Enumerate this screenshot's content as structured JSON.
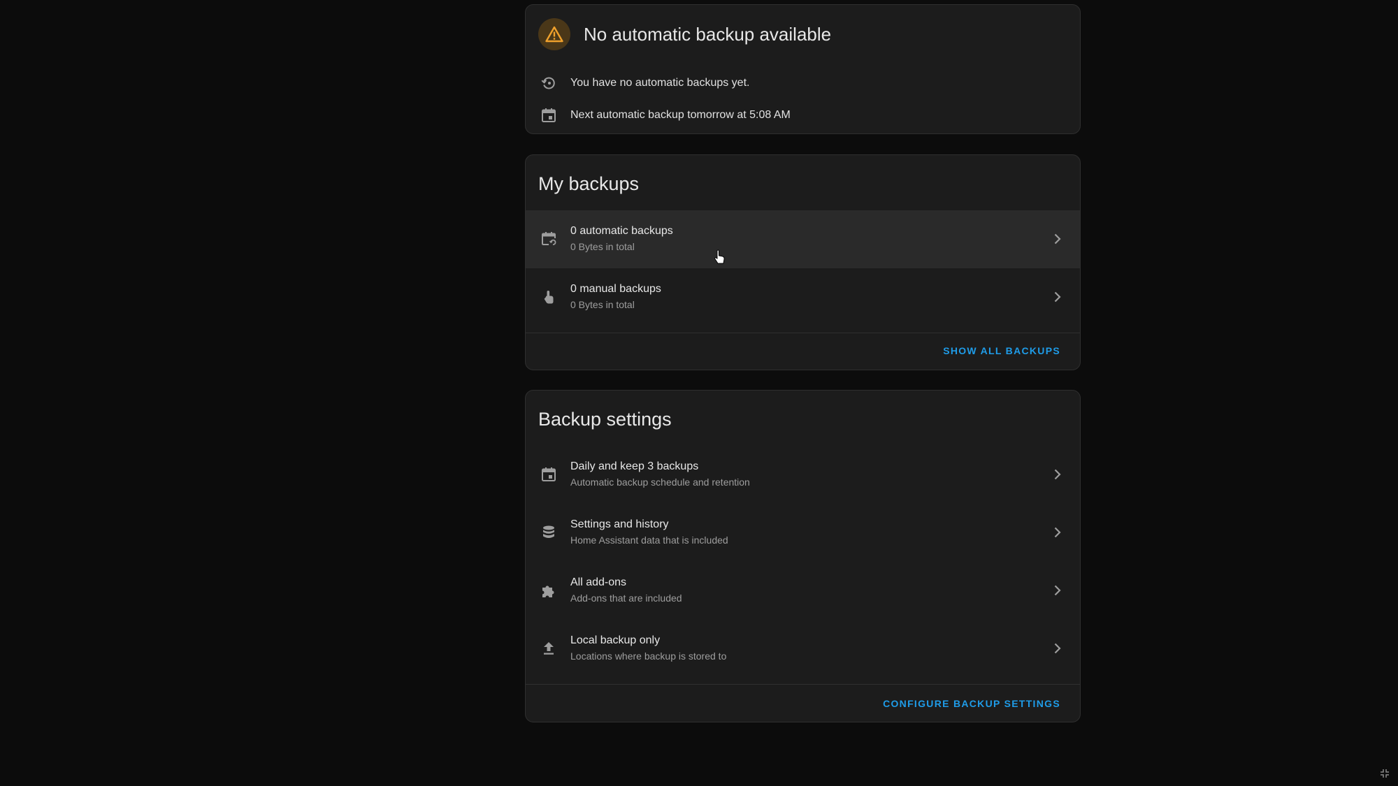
{
  "status": {
    "title": "No automatic backup available",
    "rows": [
      {
        "icon": "backup-restore-icon",
        "text": "You have no automatic backups yet."
      },
      {
        "icon": "calendar-icon",
        "text": "Next automatic backup tomorrow at 5:08 AM"
      }
    ],
    "warning_color": "#f0a12c"
  },
  "my_backups": {
    "title": "My backups",
    "items": [
      {
        "icon": "calendar-sync-icon",
        "primary": "0 automatic backups",
        "secondary": "0 Bytes in total"
      },
      {
        "icon": "gesture-tap-icon",
        "primary": "0 manual backups",
        "secondary": "0 Bytes in total"
      }
    ],
    "action_label": "SHOW ALL BACKUPS"
  },
  "backup_settings": {
    "title": "Backup settings",
    "items": [
      {
        "icon": "calendar-icon",
        "primary": "Daily and keep 3 backups",
        "secondary": "Automatic backup schedule and retention"
      },
      {
        "icon": "database-icon",
        "primary": "Settings and history",
        "secondary": "Home Assistant data that is included"
      },
      {
        "icon": "puzzle-icon",
        "primary": "All add-ons",
        "secondary": "Add-ons that are included"
      },
      {
        "icon": "upload-icon",
        "primary": "Local backup only",
        "secondary": "Locations where backup is stored to"
      }
    ],
    "action_label": "CONFIGURE BACKUP SETTINGS"
  },
  "colors": {
    "background": "#0c0c0c",
    "card": "#1c1c1c",
    "accent": "#1f9ce8",
    "icon": "#9e9e9e"
  }
}
